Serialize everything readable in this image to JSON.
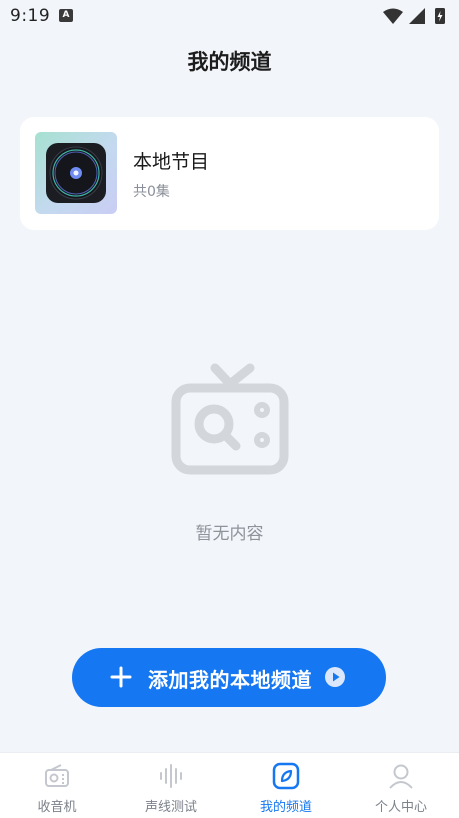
{
  "status_bar": {
    "time": "9:19",
    "indicator": "A"
  },
  "header": {
    "title": "我的频道"
  },
  "channel_card": {
    "title": "本地节目",
    "subtitle": "共0集",
    "icon": "vinyl-disc-icon"
  },
  "empty_state": {
    "icon": "tv-search-icon",
    "text": "暂无内容"
  },
  "add_button": {
    "label": "添加我的本地频道",
    "icon": "plus-icon",
    "trailing_icon": "play-circle-icon"
  },
  "tabbar": {
    "active_color": "#1677f2",
    "items": [
      {
        "label": "收音机",
        "icon": "radio-icon",
        "active": false
      },
      {
        "label": "声线测试",
        "icon": "soundwave-icon",
        "active": false
      },
      {
        "label": "我的频道",
        "icon": "channel-icon",
        "active": true
      },
      {
        "label": "个人中心",
        "icon": "person-icon",
        "active": false
      }
    ]
  },
  "colors": {
    "accent": "#1677f2",
    "background": "#f2f5f9"
  }
}
